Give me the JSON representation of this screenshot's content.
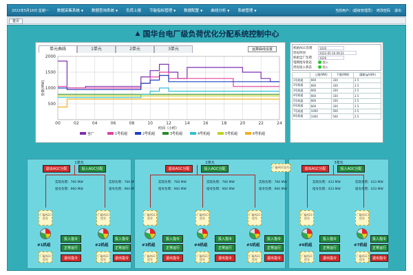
{
  "header": {
    "date": "2022年5月16日 星期一",
    "nav": [
      "数据采集系统",
      "数据查询系统",
      "负荷上报",
      "节能指标管理",
      "数据配置",
      "曲线分析",
      "系统管理"
    ],
    "user": "当前用户：(超级管理员)",
    "change_pwd": "修改密码",
    "logout": "退出"
  },
  "tabstrip": {
    "active_tab": "首页"
  },
  "main": {
    "title": "国华台电厂级负荷优化分配系统控制中心"
  },
  "chart": {
    "tabs": [
      "单元曲线",
      "1单元",
      "2单元",
      "3单元"
    ],
    "active_tab": 0,
    "setting_button": "运算曲线设置",
    "ylabel": "负荷(MW)",
    "xlabel": "时间（小时）",
    "legend": [
      "全厂",
      "1号机组",
      "2号机组",
      "3号机组",
      "4号机组",
      "5号机组",
      "6号机组"
    ]
  },
  "chart_data": {
    "type": "line",
    "x": [
      0,
      1,
      2,
      3,
      4,
      5,
      6,
      7,
      8,
      9,
      10,
      11,
      12,
      13,
      14,
      15,
      16,
      17,
      18,
      19,
      20,
      21,
      22,
      23,
      24
    ],
    "xticks": [
      "00",
      "02",
      "04",
      "06",
      "08",
      "10",
      "12",
      "14",
      "16",
      "18",
      "20",
      "22",
      "24"
    ],
    "ylim": [
      0,
      2000
    ],
    "yticks": [
      500,
      1000,
      1500,
      2000
    ],
    "series": [
      {
        "name": "全厂",
        "color": "#7b2fb0",
        "values": [
          1850,
          1000,
          1000,
          1050,
          1050,
          1050,
          1050,
          1050,
          1050,
          1350,
          1550,
          1750,
          1500,
          1300,
          1650,
          1650,
          1650,
          1650,
          1650,
          1650,
          1500,
          1500,
          1300,
          1200,
          1200
        ]
      },
      {
        "name": "1号机组",
        "color": "#e0409a",
        "values": [
          1050,
          1000,
          1000,
          1000,
          1000,
          1000,
          1000,
          1000,
          1000,
          1150,
          1350,
          1500,
          1300,
          1300,
          1300,
          1300,
          1300,
          1300,
          1300,
          1050,
          1050,
          1050,
          1050,
          1050,
          1050
        ]
      },
      {
        "name": "2号机组",
        "color": "#1f3fc0",
        "values": [
          1000,
          950,
          950,
          950,
          950,
          950,
          950,
          950,
          950,
          1150,
          1250,
          1400,
          1200,
          1200,
          1200,
          1200,
          1200,
          1200,
          1200,
          1200,
          1200,
          1200,
          1200,
          1200,
          1200
        ]
      },
      {
        "name": "3号机组",
        "color": "#2a8a2a",
        "values": [
          800,
          800,
          800,
          800,
          800,
          800,
          800,
          800,
          800,
          800,
          800,
          800,
          800,
          800,
          800,
          800,
          800,
          800,
          800,
          800,
          800,
          800,
          800,
          800,
          800
        ]
      },
      {
        "name": "4号机组",
        "color": "#30c0d0",
        "values": [
          700,
          700,
          700,
          700,
          700,
          700,
          700,
          700,
          700,
          800,
          900,
          1000,
          900,
          900,
          900,
          900,
          900,
          900,
          900,
          900,
          900,
          900,
          900,
          900,
          900
        ]
      },
      {
        "name": "5号机组",
        "color": "#c0d020",
        "values": [
          750,
          750,
          750,
          750,
          750,
          750,
          750,
          750,
          750,
          750,
          750,
          750,
          750,
          750,
          750,
          750,
          750,
          750,
          750,
          750,
          750,
          750,
          750,
          750,
          750
        ]
      },
      {
        "name": "6号机组",
        "color": "#f0b020",
        "values": [
          400,
          650,
          650,
          650,
          650,
          650,
          650,
          650,
          650,
          650,
          650,
          650,
          650,
          650,
          650,
          650,
          650,
          650,
          650,
          650,
          650,
          650,
          650,
          650,
          650
        ]
      }
    ]
  },
  "info": {
    "rows": [
      {
        "label": "机组AGC负荷",
        "value": "1020"
      },
      {
        "label": "优化时间",
        "value": "2022-05-16 09:21"
      },
      {
        "label": "机组全厂负荷",
        "value": "1020"
      },
      {
        "label": "电网指令状态",
        "value": "投入"
      },
      {
        "label": "优化投入状态",
        "value": "投入"
      }
    ],
    "table_headers": [
      "",
      "上限(MW)",
      "下限(MW)",
      "煤耗(g/kWh)"
    ],
    "table_rows": [
      [
        "1号机组",
        "660",
        "330",
        "2.5"
      ],
      [
        "2号机组",
        "660",
        "330",
        "2.5"
      ],
      [
        "3号机组",
        "660",
        "330",
        "2.5"
      ],
      [
        "4号机组",
        "660",
        "330",
        "2.5"
      ],
      [
        "5号机组",
        "660",
        "330",
        "2.5"
      ],
      [
        "6号机组",
        "660",
        "330",
        "2.5"
      ],
      [
        "7号机组",
        "1000",
        "500",
        "2.5"
      ],
      [
        "8号机组",
        "1000",
        "500",
        "2.5"
      ]
    ]
  },
  "units": [
    {
      "title": "1单元",
      "agc_off": "退出AGC分配",
      "agc_on": "投入AGC分配",
      "readouts": [
        "实际负荷：766 MW",
        "指令负荷：960 MW",
        "实际负荷：766 MW",
        "指令负荷：960 MW"
      ],
      "machines": [
        {
          "label": "#1机组",
          "box": "厂级AGC信号",
          "status": "正常运行",
          "btn_a": "投入指令",
          "btn_b": "退出指令"
        },
        {
          "label": "#2机组",
          "box": "厂级AGC信号",
          "status": "正常运行",
          "btn_a": "投入指令",
          "btn_b": "退出指令"
        }
      ]
    },
    {
      "title": "2单元",
      "agc_off": "退出AGC分配",
      "agc_on": "投入AGC分配",
      "readouts": [
        "实际负荷：768 MW",
        "指令负荷：960 MW",
        "实际负荷：766 MW",
        "指令负荷：960 MW",
        "实际负荷：766 MW",
        "指令负荷：960 MW"
      ],
      "machines": [
        {
          "label": "#3机组",
          "box": "厂级AGC信号",
          "status": "正常运行",
          "btn_a": "投入指令",
          "btn_b": "退出指令"
        },
        {
          "label": "#4机组",
          "box": "厂级AGC信号",
          "status": "正常运行",
          "btn_a": "投入指令",
          "btn_b": "退出指令"
        },
        {
          "label": "#5机组",
          "box": "厂级AGC信号",
          "status": "正常运行",
          "btn_a": "投入指令",
          "btn_b": "退出指令"
        }
      ]
    },
    {
      "title": "3单元",
      "agc_off": "退出AGC分配",
      "agc_on": "投入AGC分配",
      "floating": "厂级AGC信号",
      "readouts": [
        "实际负荷：433 MW",
        "指令负荷：433 MW",
        "实际负荷：433 MW",
        "指令负荷：433 MW"
      ],
      "machines": [
        {
          "label": "#6机组",
          "box": "厂级AGC信号",
          "status": "正常运行",
          "btn_a": "投入指令",
          "btn_b": "退出指令"
        },
        {
          "label": "#7机组",
          "box": "厂级AGC信号",
          "status": "正常运行",
          "btn_a": "投入指令",
          "btn_b": "退出指令"
        }
      ]
    }
  ]
}
